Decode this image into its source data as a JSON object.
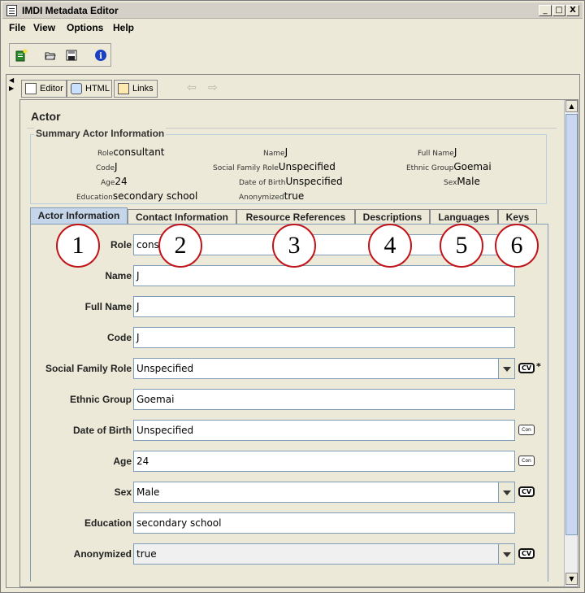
{
  "window": {
    "title": "IMDI Metadata Editor",
    "controls": [
      "_",
      "□",
      "X"
    ]
  },
  "menu": [
    "File",
    "View",
    "Options",
    "Help"
  ],
  "toolbar": {
    "icons": [
      "new-document-icon",
      "open-folder-icon",
      "save-icon",
      "info-icon"
    ]
  },
  "view_tabs": [
    {
      "label": "Editor",
      "icon": "document-icon"
    },
    {
      "label": "HTML",
      "icon": "browser-icon"
    },
    {
      "label": "Links",
      "icon": "links-icon"
    }
  ],
  "actor": {
    "heading": "Actor",
    "summary_title": "Summary Actor Information",
    "summary": [
      {
        "key": "Role",
        "value": "consultant"
      },
      {
        "key": "Name",
        "value": "J"
      },
      {
        "key": "Full Name",
        "value": "J"
      },
      {
        "key": "Code",
        "value": "J"
      },
      {
        "key": "Social Family Role",
        "value": "Unspecified"
      },
      {
        "key": "Ethnic Group",
        "value": "Goemai"
      },
      {
        "key": "Age",
        "value": "24"
      },
      {
        "key": "Date of Birth",
        "value": "Unspecified"
      },
      {
        "key": "Sex",
        "value": "Male"
      },
      {
        "key": "Education",
        "value": "secondary school"
      },
      {
        "key": "Anonymized",
        "value": "true"
      }
    ]
  },
  "tabs": [
    "Actor Information",
    "Contact Information",
    "Resource References",
    "Descriptions",
    "Languages",
    "Keys"
  ],
  "active_tab": 0,
  "form": [
    {
      "label": "Role",
      "value": "consu",
      "type": "text"
    },
    {
      "label": "Name",
      "value": "J",
      "type": "text"
    },
    {
      "label": "Full Name",
      "value": "J",
      "type": "text"
    },
    {
      "label": "Code",
      "value": "J",
      "type": "text"
    },
    {
      "label": "Social Family Role",
      "value": "Unspecified",
      "type": "dropdown",
      "badge": "CV",
      "required": "*"
    },
    {
      "label": "Ethnic Group",
      "value": "Goemai",
      "type": "text"
    },
    {
      "label": "Date of Birth",
      "value": "Unspecified",
      "type": "text",
      "badge": "Con"
    },
    {
      "label": "Age",
      "value": "24",
      "type": "text",
      "badge": "Con"
    },
    {
      "label": "Sex",
      "value": "Male",
      "type": "dropdown",
      "badge": "CV"
    },
    {
      "label": "Education",
      "value": "secondary school",
      "type": "text"
    },
    {
      "label": "Anonymized",
      "value": "true",
      "type": "dropdown",
      "badge": "CV"
    }
  ],
  "callouts": [
    "1",
    "2",
    "3",
    "4",
    "5",
    "6"
  ]
}
